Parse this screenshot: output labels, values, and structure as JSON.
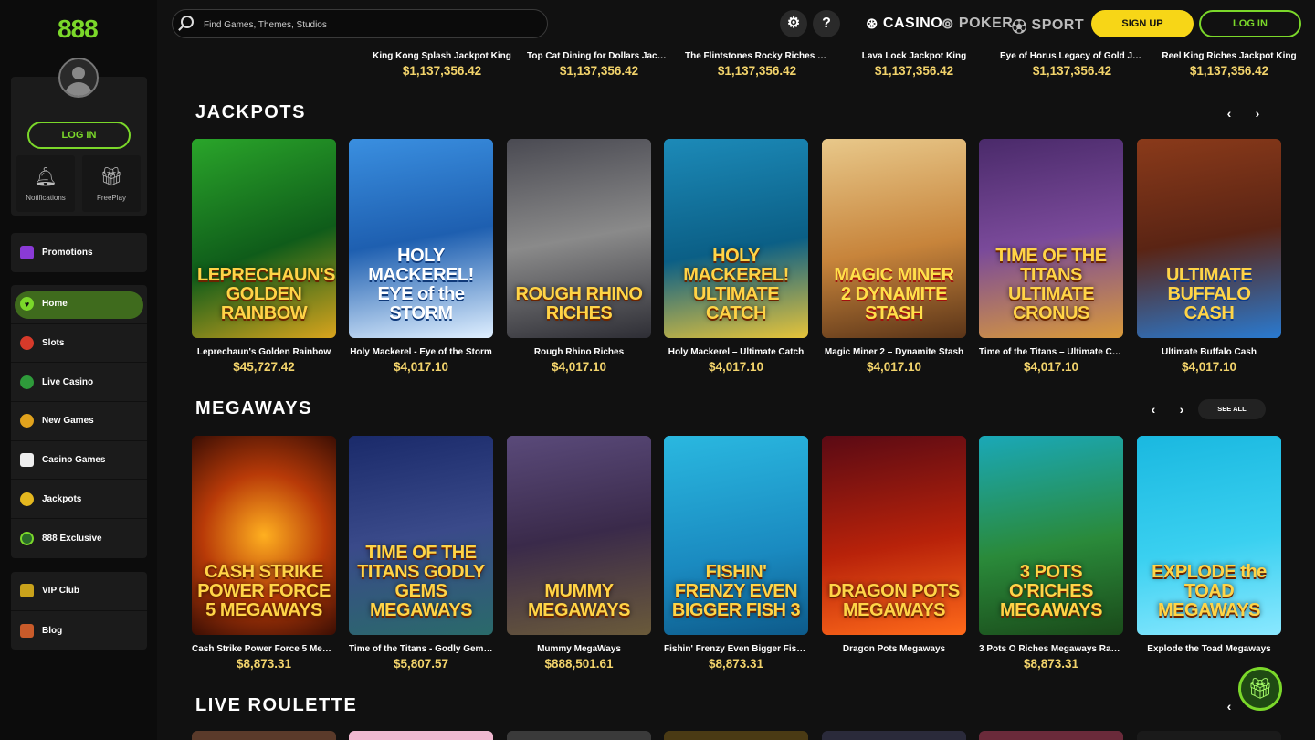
{
  "brand": {
    "logo": "888"
  },
  "sidebar": {
    "login_label": "LOG IN",
    "tiles": [
      {
        "label": "Notifications",
        "icon": "bell-icon"
      },
      {
        "label": "FreePlay",
        "icon": "gift-icon"
      }
    ],
    "promotions": {
      "label": "Promotions"
    },
    "nav": [
      {
        "label": "Home",
        "active": true
      },
      {
        "label": "Slots"
      },
      {
        "label": "Live Casino"
      },
      {
        "label": "New Games"
      },
      {
        "label": "Casino Games"
      },
      {
        "label": "Jackpots"
      },
      {
        "label": "888 Exclusive"
      }
    ],
    "extra": [
      {
        "label": "VIP Club"
      },
      {
        "label": "Blog"
      }
    ]
  },
  "header": {
    "search_placeholder": "Find Games, Themes, Studios",
    "settings_icon": "gear-icon",
    "help_label": "?",
    "products": [
      "CASINO",
      "POKER",
      "SPORT"
    ],
    "signup_label": "SIGN UP",
    "login_label": "LOG IN"
  },
  "top_row": [
    {
      "name": "King Kong Splash Jackpot King",
      "value": "$1,137,356.42"
    },
    {
      "name": "Top Cat Dining for Dollars Jackpot ...",
      "value": "$1,137,356.42"
    },
    {
      "name": "The Flintstones Rocky Riches Jack...",
      "value": "$1,137,356.42"
    },
    {
      "name": "Lava Lock Jackpot King",
      "value": "$1,137,356.42"
    },
    {
      "name": "Eye of Horus Legacy of Gold Jackp...",
      "value": "$1,137,356.42"
    },
    {
      "name": "Reel King Riches Jackpot King",
      "value": "$1,137,356.42"
    }
  ],
  "jackpots": {
    "title": "JACKPOTS",
    "games": [
      {
        "name": "Leprechaun's Golden Rainbow",
        "value": "$45,727.42",
        "art": "LEPRECHAUN'S GOLDEN RAINBOW"
      },
      {
        "name": "Holy Mackerel - Eye of the Storm",
        "value": "$4,017.10",
        "art": "HOLY MACKEREL! EYE of the STORM"
      },
      {
        "name": "Rough Rhino Riches",
        "value": "$4,017.10",
        "art": "ROUGH RHINO RICHES"
      },
      {
        "name": "Holy Mackerel – Ultimate Catch",
        "value": "$4,017.10",
        "art": "HOLY MACKEREL! ULTIMATE CATCH"
      },
      {
        "name": "Magic Miner 2 – Dynamite Stash",
        "value": "$4,017.10",
        "art": "MAGIC MINER 2 DYNAMITE STASH"
      },
      {
        "name": "Time of the Titans – Ultimate Cronus",
        "value": "$4,017.10",
        "art": "TIME OF THE TITANS ULTIMATE CRONUS"
      },
      {
        "name": "Ultimate Buffalo Cash",
        "value": "$4,017.10",
        "art": "ULTIMATE BUFFALO CASH"
      }
    ]
  },
  "megaways": {
    "title": "MEGAWAYS",
    "see_all": "SEE ALL",
    "games": [
      {
        "name": "Cash Strike Power Force 5 Megawa...",
        "value": "$8,873.31",
        "art": "CASH STRIKE POWER FORCE 5 MEGAWAYS"
      },
      {
        "name": "Time of the Titans - Godly Gems M...",
        "value": "$5,807.57",
        "art": "TIME OF THE TITANS GODLY GEMS MEGAWAYS"
      },
      {
        "name": "Mummy MegaWays",
        "value": "$888,501.61",
        "art": "MUMMY MEGAWAYS"
      },
      {
        "name": "Fishin' Frenzy Even Bigger Fish 3 M...",
        "value": "$8,873.31",
        "art": "FISHIN' FRENZY EVEN BIGGER FISH 3"
      },
      {
        "name": "Dragon Pots Megaways",
        "value": "",
        "art": "DRAGON POTS MEGAWAYS"
      },
      {
        "name": "3 Pots O Riches Megaways Rapid Fi...",
        "value": "$8,873.31",
        "art": "3 POTS O'RICHES MEGAWAYS"
      },
      {
        "name": "Explode the Toad Megaways",
        "value": "",
        "art": "EXPLODE the TOAD MEGAWAYS"
      }
    ]
  },
  "live_roulette": {
    "title": "LIVE ROULETTE"
  },
  "colors": {
    "brand_green": "#7bd82a",
    "signup_yellow": "#f7d617",
    "value_gold": "#f2d36b"
  }
}
